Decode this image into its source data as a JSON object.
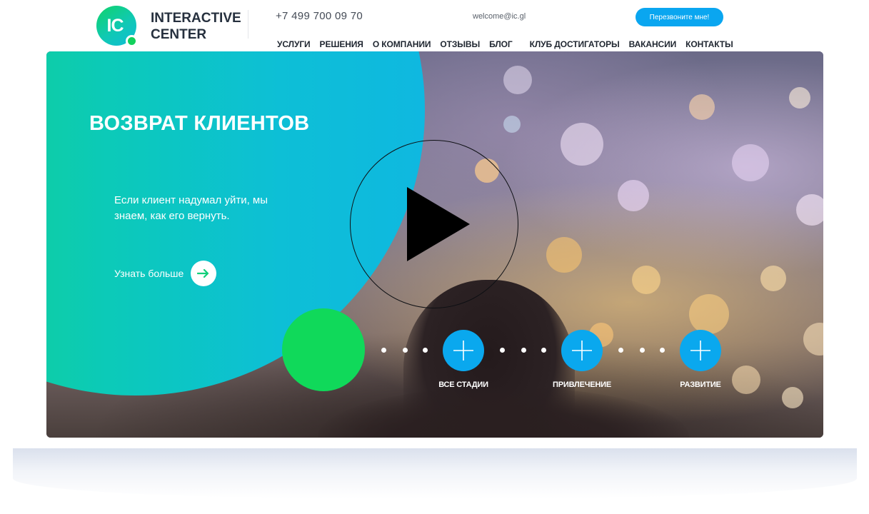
{
  "header": {
    "logo": {
      "mark": "IC",
      "name": "INTERACTIVE CENTER"
    },
    "phone": "+7 499 700 09 70",
    "email": "welcome@ic.gl",
    "callback_label": "Перезвоните мне!",
    "nav": [
      {
        "label": "Услуги"
      },
      {
        "label": "Решения"
      },
      {
        "label": "О компании"
      },
      {
        "label": "Отзывы"
      },
      {
        "label": "Блог"
      },
      {
        "label": "Клуб Достигаторы"
      },
      {
        "label": "Вакансии"
      },
      {
        "label": "Контакты"
      }
    ]
  },
  "hero": {
    "title": "ВОЗВРАТ КЛИЕНТОВ",
    "subtitle": "Если клиент надумал уйти, мы знаем, как его вернуть.",
    "more_label": "Узнать больше",
    "stages": [
      {
        "label": "ВСЕ СТАДИИ"
      },
      {
        "label": "ПРИВЛЕЧЕНИЕ"
      },
      {
        "label": "РАЗВИТИЕ"
      }
    ]
  },
  "icons": [
    "play-icon",
    "arrow-right-icon",
    "plus-icon"
  ],
  "colors": {
    "accent_blue": "#0aa6f0",
    "teal_start": "#12d47a",
    "teal_end": "#0fb8e0",
    "green_dot": "#10d95a",
    "nav_text": "#1f2630"
  }
}
